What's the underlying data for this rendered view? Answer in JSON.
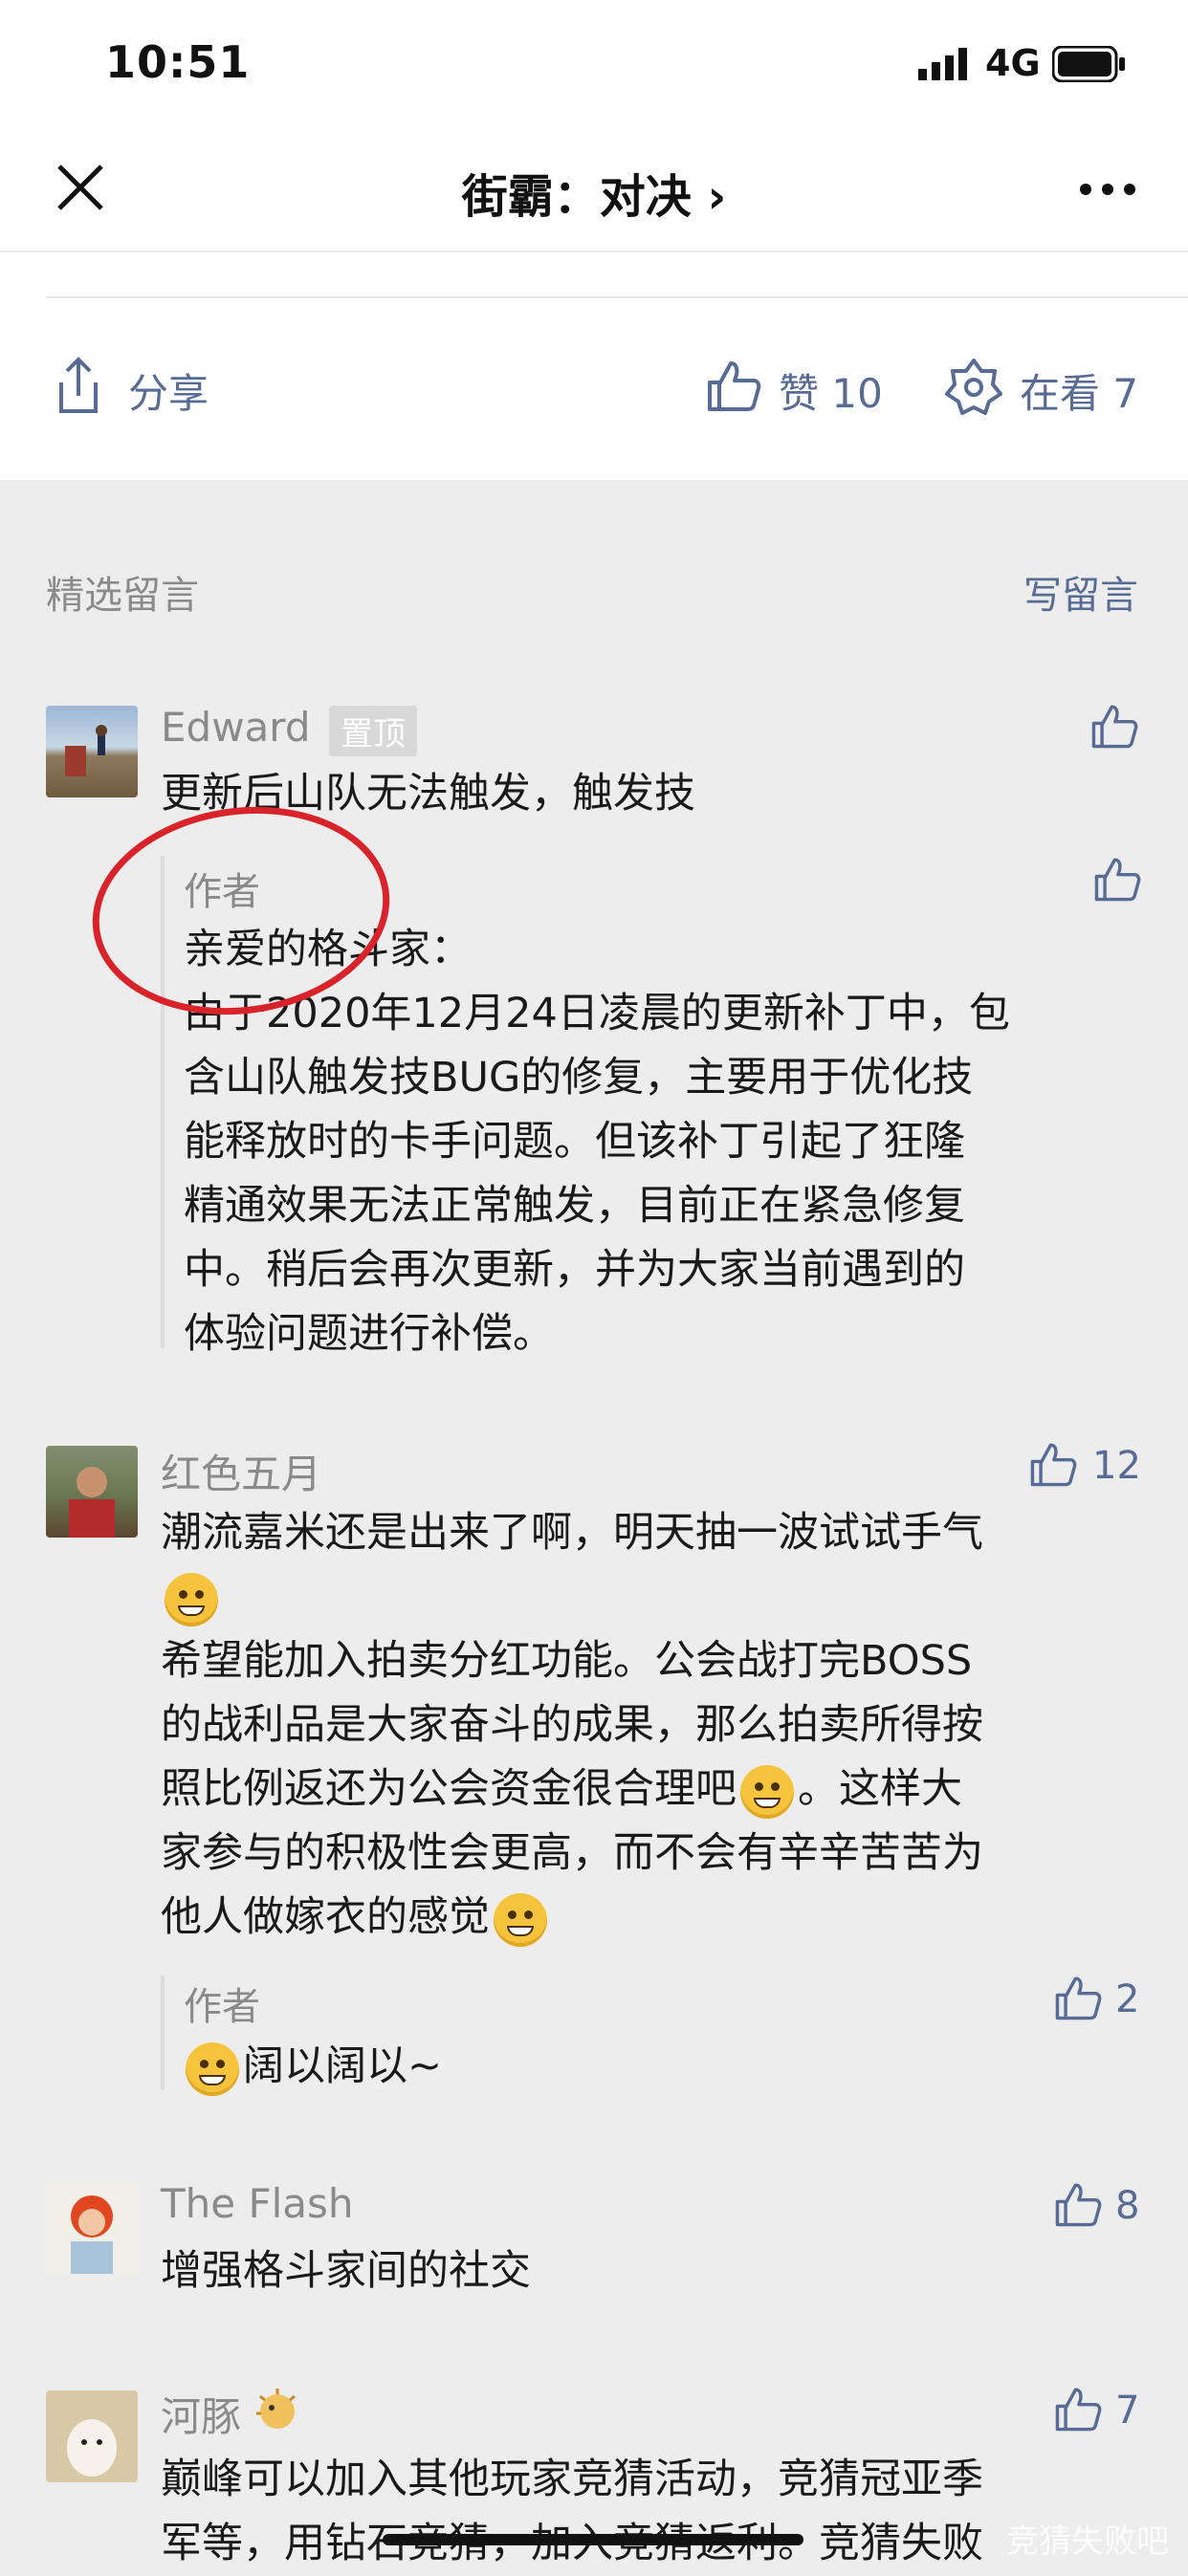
{
  "status_bar": {
    "time": "10:51",
    "network": "4G"
  },
  "nav": {
    "title": "街霸：对决 ›"
  },
  "actions": {
    "share": "分享",
    "like": "赞 10",
    "watching": "在看 7"
  },
  "section": {
    "label": "精选留言",
    "write": "写留言"
  },
  "comments": [
    {
      "name": "Edward",
      "badge": "置顶",
      "text": "更新后山队无法触发，触发技",
      "reply": {
        "author": "作者",
        "lines": [
          "亲爱的格斗家：",
          "由于2020年12月24日凌晨的更新补丁中，包",
          "含山队触发技BUG的修复，主要用于优化技",
          "能释放时的卡手问题。但该补丁引起了狂隆",
          "精通效果无法正常触发，目前正在紧急修复",
          "中。稍后会再次更新，并为大家当前遇到的",
          "体验问题进行补偿。"
        ]
      }
    },
    {
      "name": "红色五月",
      "likes": "12",
      "lines": [
        "潮流嘉米还是出来了啊，明天抽一波试试手气",
        "",
        "希望能加入拍卖分红功能。公会战打完BOSS",
        "的战利品是大家奋斗的成果，那么拍卖所得按",
        "照比例返还为公会资金很合理吧",
        "。这样大",
        "家参与的积极性会更高，而不会有辛辛苦苦为",
        "他人做嫁衣的感觉"
      ],
      "reply": {
        "author": "作者",
        "likes": "2",
        "text": "阔以阔以~"
      }
    },
    {
      "name": "The Flash",
      "likes": "8",
      "text": "增强格斗家间的社交"
    },
    {
      "name": "河豚",
      "likes": "7",
      "lines": [
        "巅峰可以加入其他玩家竞猜活动，竞猜冠亚季",
        "军等，用钻石竞猜，加入竞猜返利。竞猜失败"
      ]
    }
  ],
  "watermark": "竞猜失败吧",
  "icons": [
    "close-icon",
    "chevron-right-icon",
    "more-icon",
    "share-icon",
    "thumb-up-icon",
    "watching-icon",
    "grin-emoji",
    "smirk-emoji"
  ],
  "colors": {
    "link": "#576b95",
    "annotation": "#d8232a",
    "background": "#ededed"
  }
}
